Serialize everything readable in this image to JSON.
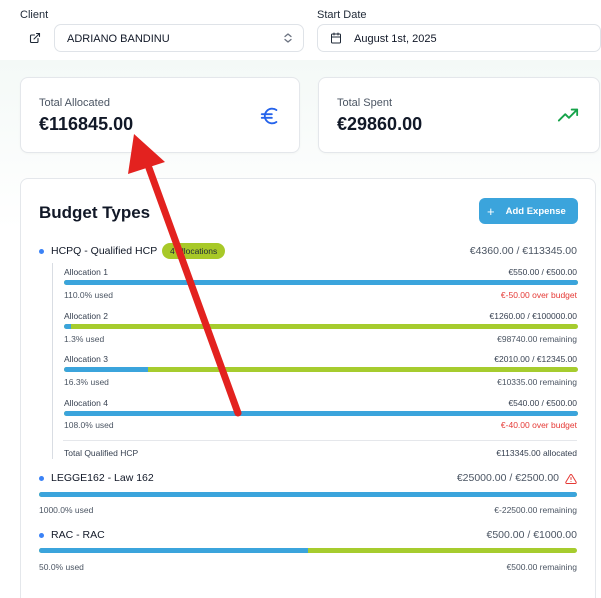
{
  "filters": {
    "client_label": "Client",
    "client_value": "ADRIANO BANDINU",
    "start_date_label": "Start Date",
    "start_date_value": "August 1st, 2025"
  },
  "stats": {
    "total_allocated_label": "Total Allocated",
    "total_allocated_value": "€116845.00",
    "total_spent_label": "Total Spent",
    "total_spent_value": "€29860.00"
  },
  "budget": {
    "title": "Budget Types",
    "add_button_label": "Add Expense",
    "types": [
      {
        "name": "HCPQ - Qualified HCP",
        "badge": "4 allocations",
        "amount": "€4360.00 / €113345.00",
        "allocations": [
          {
            "name": "Allocation 1",
            "amount": "€550.00 / €500.00",
            "used_text": "110.0% used",
            "status": "€-50.00 over budget",
            "used_fraction": 1.0
          },
          {
            "name": "Allocation 2",
            "amount": "€1260.00 / €100000.00",
            "used_text": "1.3% used",
            "status": "€98740.00 remaining",
            "used_fraction": 0.013
          },
          {
            "name": "Allocation 3",
            "amount": "€2010.00 / €12345.00",
            "used_text": "16.3% used",
            "status": "€10335.00 remaining",
            "used_fraction": 0.163
          },
          {
            "name": "Allocation 4",
            "amount": "€540.00 / €500.00",
            "used_text": "108.0% used",
            "status": "€-40.00 over budget",
            "used_fraction": 1.0
          }
        ],
        "total_label": "Total Qualified HCP",
        "total_value": "€113345.00 allocated"
      },
      {
        "name": "LEGGE162 - Law 162",
        "amount": "€25000.00 / €2500.00",
        "used_text": "1000.0% used",
        "status": "€-22500.00 remaining",
        "used_fraction": 1.0
      },
      {
        "name": "RAC - RAC",
        "amount": "€500.00 / €1000.00",
        "used_text": "50.0% used",
        "status": "€500.00 remaining",
        "used_fraction": 0.5
      }
    ]
  },
  "colors": {
    "primary_blue": "#3ba4dc",
    "remaining_green": "#a6cc2e",
    "over_budget_red": "#e53935",
    "annotation_red": "#e3221f",
    "trend_green": "#16a34a",
    "euro_blue": "#2563eb"
  },
  "icons": {
    "client_link": "external-link-icon",
    "client_select": "chevron-up-down-icon",
    "date": "calendar-icon",
    "allocated": "euro-icon",
    "spent": "trending-up-icon",
    "add": "plus-icon",
    "warning": "warning-icon"
  }
}
